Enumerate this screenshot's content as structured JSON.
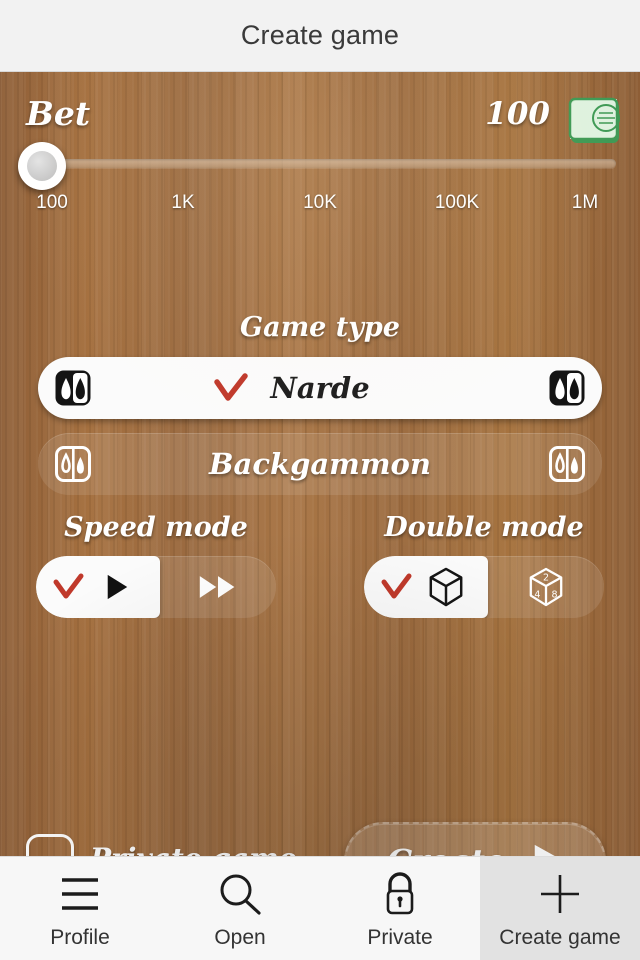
{
  "header": {
    "title": "Create game"
  },
  "bet": {
    "label": "Bet",
    "value": "100",
    "money_icon": "banknote-icon",
    "slider": {
      "thumb_position_percent": 0,
      "ticks": [
        "100",
        "1K",
        "10K",
        "100K",
        "1M"
      ]
    }
  },
  "game_type": {
    "heading": "Game type",
    "options": [
      {
        "label": "Narde",
        "selected": true,
        "icon": "narde-board-icon"
      },
      {
        "label": "Backgammon",
        "selected": false,
        "icon": "backgammon-board-icon"
      }
    ]
  },
  "speed_mode": {
    "heading": "Speed mode",
    "options": [
      {
        "icon": "play-icon",
        "selected": true
      },
      {
        "icon": "fast-forward-icon",
        "selected": false
      }
    ]
  },
  "double_mode": {
    "heading": "Double mode",
    "options": [
      {
        "icon": "plain-cube-icon",
        "selected": true
      },
      {
        "icon": "doubling-cube-icon",
        "selected": false,
        "faces": [
          "2",
          "4",
          "8"
        ]
      }
    ]
  },
  "private_game": {
    "label": "Private game",
    "checked": false
  },
  "create_button": {
    "label": "Create",
    "icon": "play-arrow-icon"
  },
  "navbar": {
    "items": [
      {
        "label": "Profile",
        "icon": "hamburger-icon",
        "active": false
      },
      {
        "label": "Open",
        "icon": "search-icon",
        "active": false
      },
      {
        "label": "Private",
        "icon": "lock-icon",
        "active": false
      },
      {
        "label": "Create game",
        "icon": "plus-icon",
        "active": true
      }
    ]
  },
  "colors": {
    "wood": "#9c6b42",
    "titlebar": "#f2f2f2",
    "accent_check": "#c0392b",
    "money_green": "#4aa05a",
    "selected_pill": "#fbfbfb",
    "nav_active": "#e2e2e2"
  }
}
